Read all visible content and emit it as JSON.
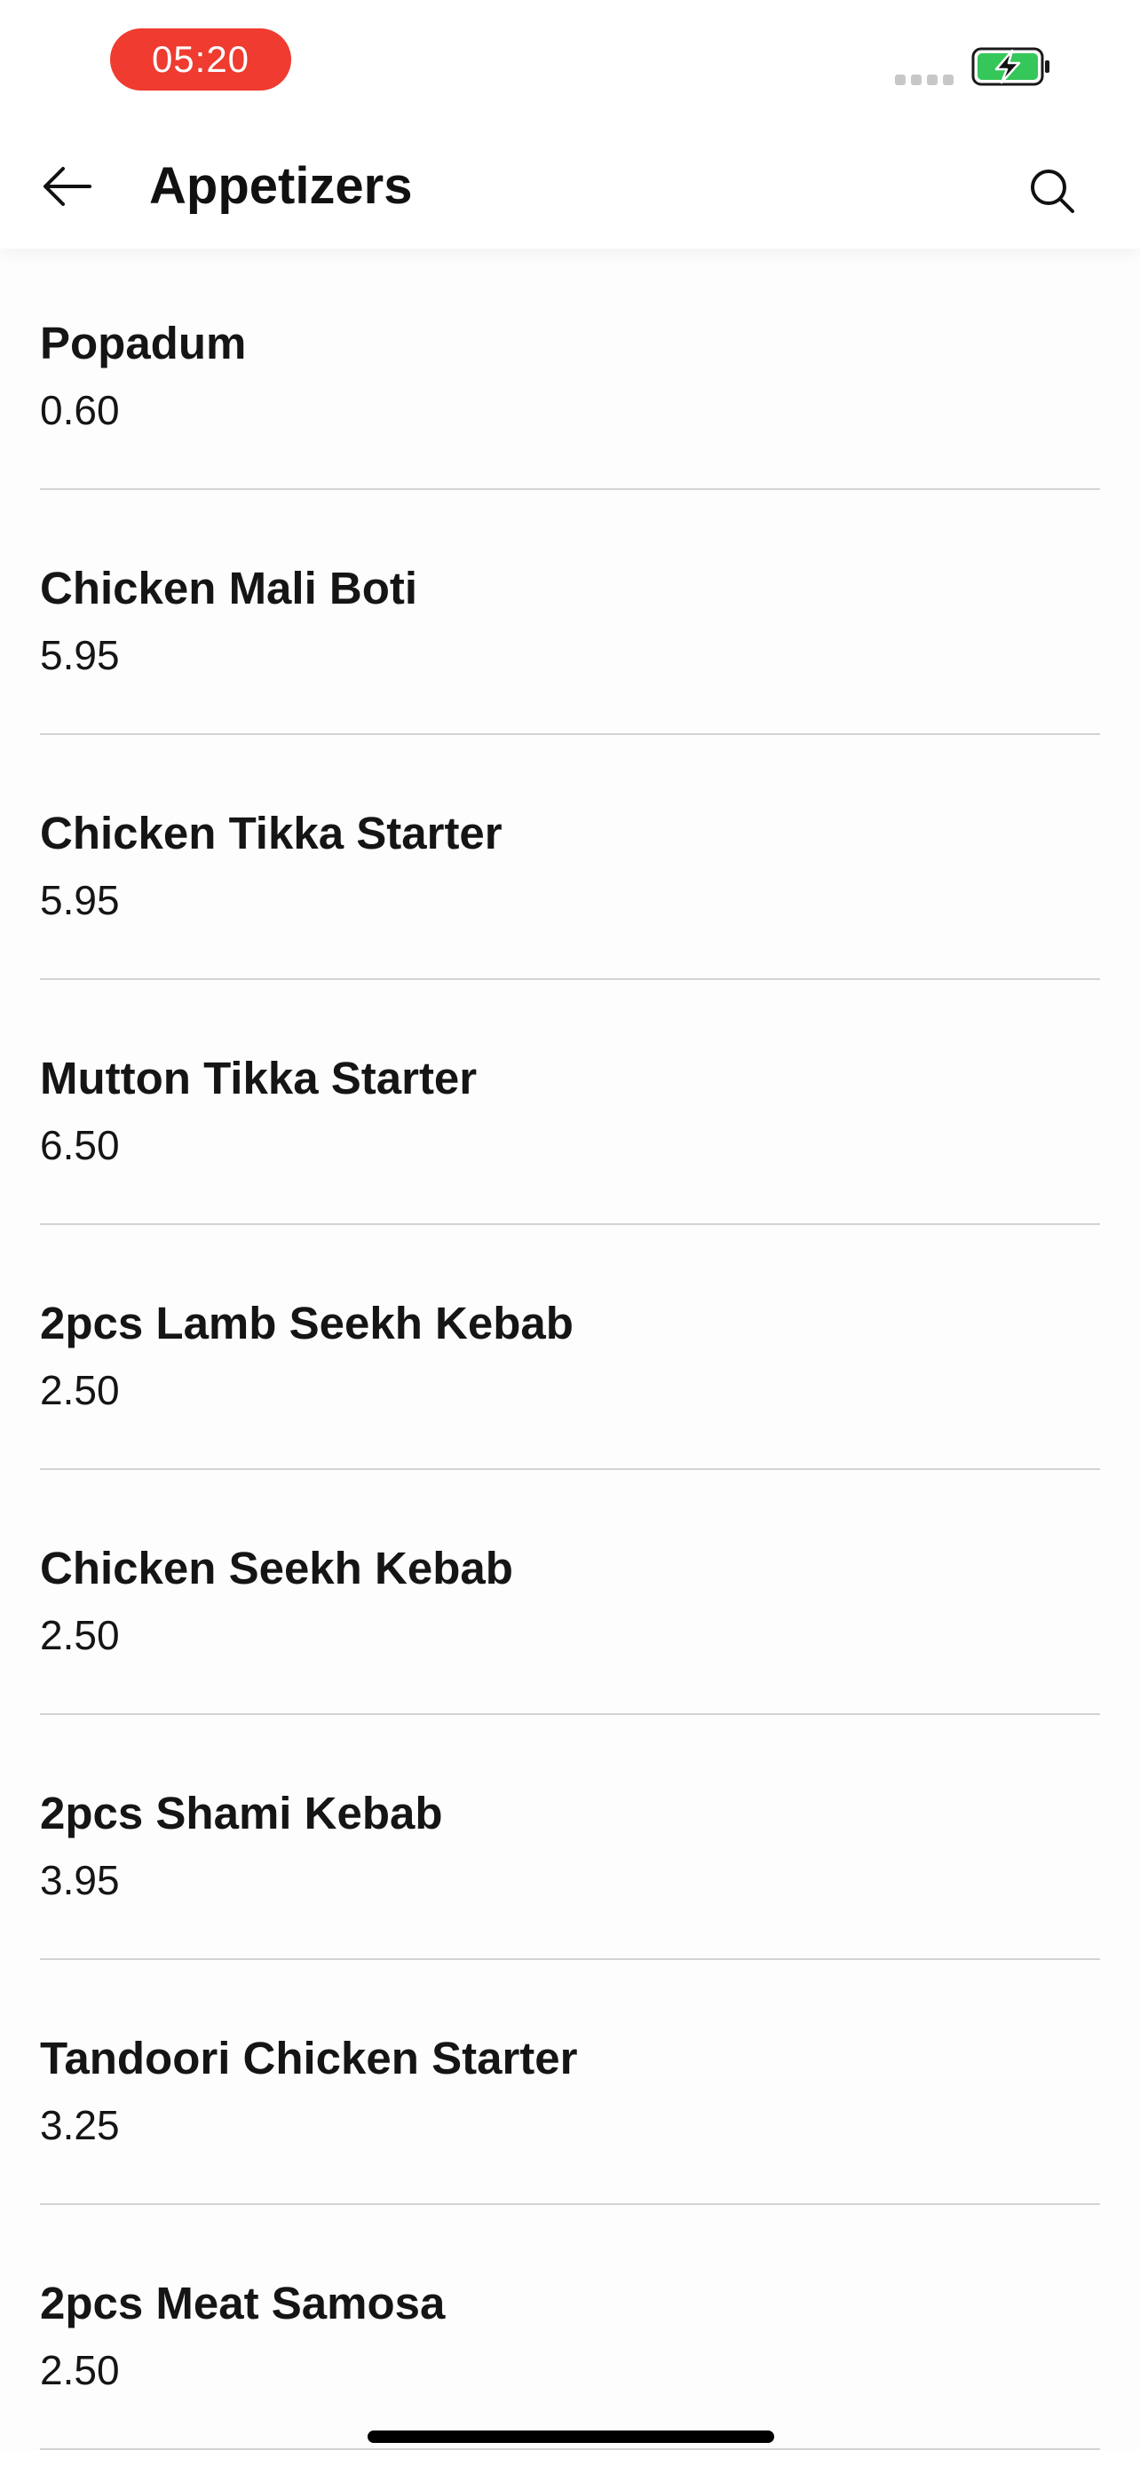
{
  "status_bar": {
    "time": "05:20",
    "time_pill_color": "#ef3b30",
    "battery_color": "#35c759",
    "battery_state": "charging"
  },
  "header": {
    "title": "Appetizers",
    "back_icon": "arrow-left-icon",
    "search_icon": "search-icon"
  },
  "menu": {
    "items": [
      {
        "name": "Popadum",
        "price": "0.60"
      },
      {
        "name": "Chicken Mali Boti",
        "price": "5.95"
      },
      {
        "name": "Chicken Tikka Starter",
        "price": "5.95"
      },
      {
        "name": "Mutton Tikka Starter",
        "price": "6.50"
      },
      {
        "name": "2pcs Lamb Seekh Kebab",
        "price": "2.50"
      },
      {
        "name": "Chicken Seekh Kebab",
        "price": "2.50"
      },
      {
        "name": "2pcs Shami Kebab",
        "price": "3.95"
      },
      {
        "name": "Tandoori Chicken Starter",
        "price": "3.25"
      },
      {
        "name": "2pcs Meat Samosa",
        "price": "2.50"
      }
    ]
  }
}
